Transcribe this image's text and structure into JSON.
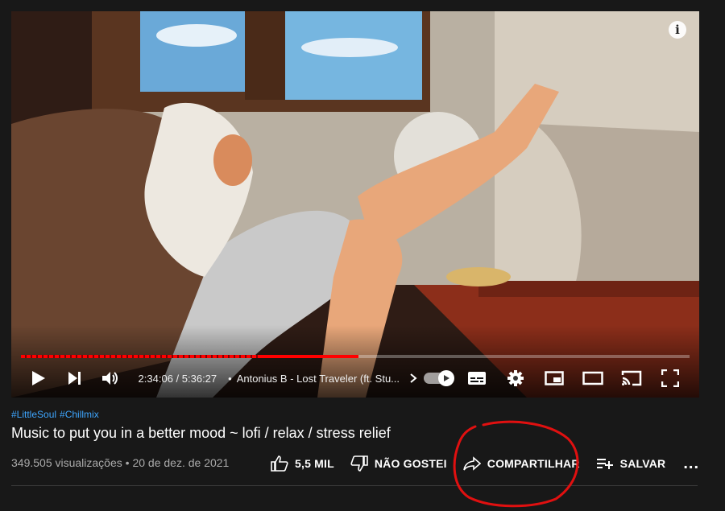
{
  "player": {
    "info_icon": "i",
    "progress_played": 0.505,
    "progress_buffer": 0.505,
    "time_current": "2:34:06",
    "time_separator": " / ",
    "time_total": "5:36:27",
    "chapter_dot": "•",
    "chapter_title": "Antonius B - Lost Traveler (ft. Stu...",
    "icons": [
      "play-icon",
      "next-icon",
      "volume-icon",
      "chevron-right-icon",
      "autoplay-toggle-icon",
      "subtitles-icon",
      "settings-icon",
      "miniplayer-icon",
      "theater-icon",
      "cast-icon",
      "fullscreen-icon"
    ]
  },
  "video": {
    "hashtags": [
      "#LittleSoul",
      "#Chillmix"
    ],
    "title": "Music to put you in a better mood ~ lofi / relax / stress relief",
    "views": "349.505 visualizações",
    "date_separator": " • ",
    "date": "20 de dez. de 2021"
  },
  "actions": {
    "like_label": "5,5 MIL",
    "dislike_label": "NÃO GOSTEI",
    "share_label": "COMPARTILHAR",
    "save_label": "SALVAR",
    "more_label": "..."
  },
  "colors": {
    "background": "#181818",
    "progress": "#ff0000",
    "hashtag": "#3ea6ff",
    "annotation": "#e01010"
  }
}
